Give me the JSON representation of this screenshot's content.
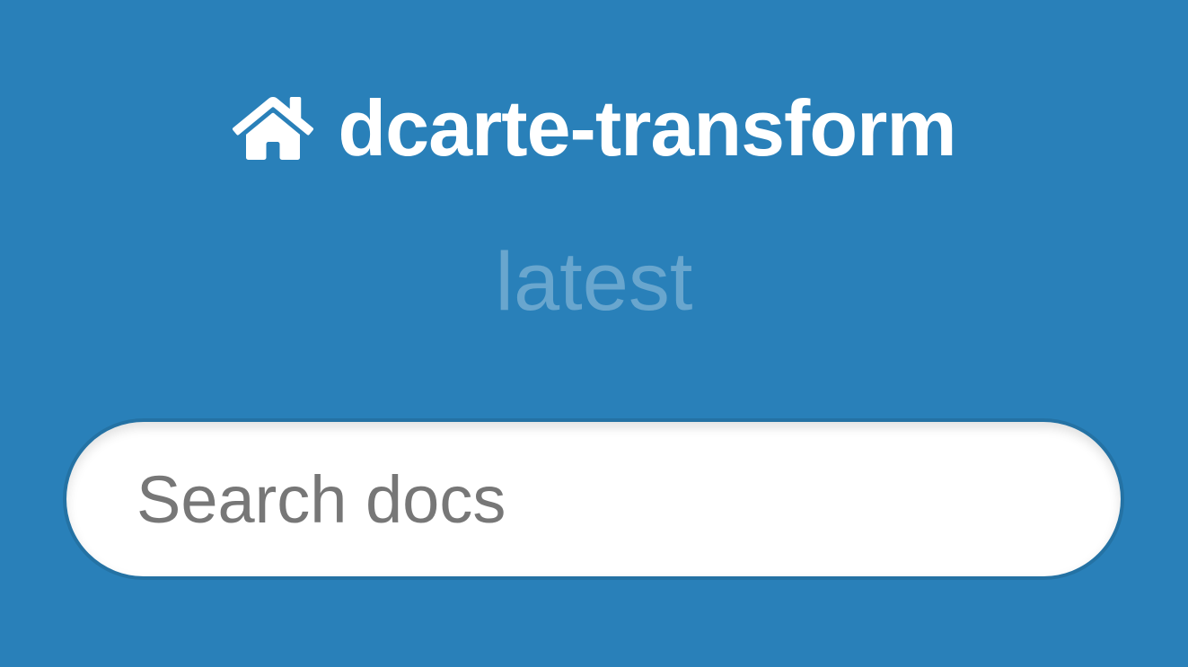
{
  "header": {
    "home_icon": "home-icon",
    "project_name": "dcarte-transform",
    "version": "latest"
  },
  "search": {
    "placeholder": "Search docs",
    "value": ""
  },
  "colors": {
    "background": "#2980b9",
    "text": "#ffffff",
    "version_text": "rgba(255,255,255,0.3)",
    "search_placeholder": "#777777",
    "search_background": "#ffffff"
  }
}
